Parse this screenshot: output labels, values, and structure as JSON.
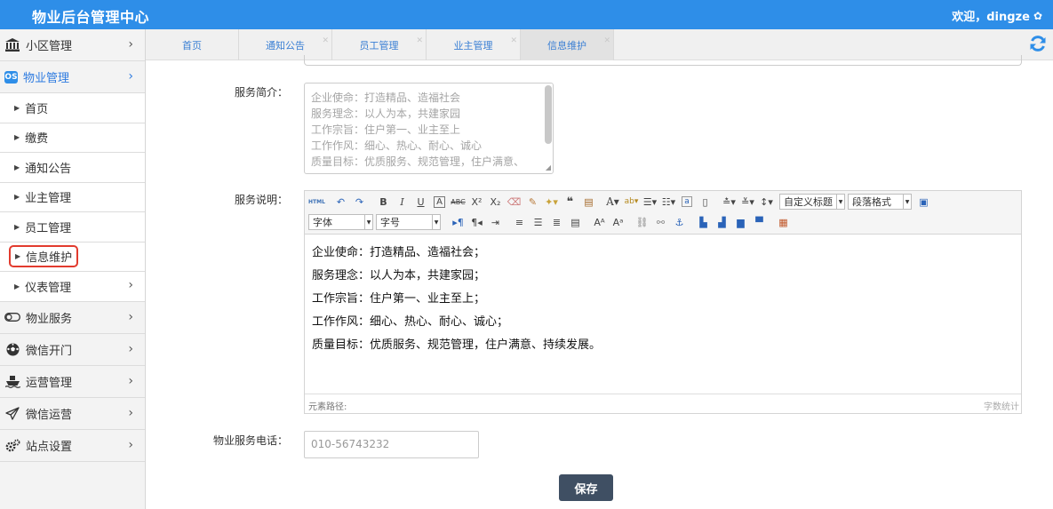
{
  "header": {
    "title": "物业后台管理中心",
    "welcome": "欢迎，dingze",
    "settings_icon": "gear-icon"
  },
  "sidebar": {
    "groups": [
      {
        "label": "小区管理",
        "icon": "building-icon"
      },
      {
        "label": "物业管理",
        "icon": "property-icon",
        "icon_text": "OS",
        "active": true
      },
      {
        "label": "物业服务",
        "icon": "toggle-icon"
      },
      {
        "label": "微信开门",
        "icon": "soccer-icon"
      },
      {
        "label": "运营管理",
        "icon": "ship-icon"
      },
      {
        "label": "微信运营",
        "icon": "paper-plane-icon"
      },
      {
        "label": "站点设置",
        "icon": "gears-icon"
      }
    ],
    "sub_items": [
      {
        "label": "首页"
      },
      {
        "label": "缴费"
      },
      {
        "label": "通知公告"
      },
      {
        "label": "业主管理"
      },
      {
        "label": "员工管理"
      },
      {
        "label": "信息维护",
        "current": true
      },
      {
        "label": "仪表管理",
        "has_children": true
      }
    ]
  },
  "tabs": [
    {
      "label": "首页",
      "closable": false
    },
    {
      "label": "通知公告",
      "closable": true
    },
    {
      "label": "员工管理",
      "closable": true
    },
    {
      "label": "业主管理",
      "closable": true
    },
    {
      "label": "信息维护",
      "closable": true,
      "active": true
    }
  ],
  "form": {
    "intro_label": "服务简介：",
    "intro_lines": [
      "企业使命：打造精品、造福社会",
      "服务理念：以人为本，共建家园",
      "工作宗旨：住户第一、业主至上",
      "工作作风：细心、热心、耐心、诚心",
      "质量目标：优质服务、规范管理，住户满意、"
    ],
    "desc_label": "服务说明：",
    "editor": {
      "font_select": "字体",
      "size_select": "字号",
      "custom_title_select": "自定义标题",
      "paragraph_select": "段落格式",
      "html_button": "HTML",
      "content_lines": [
        "企业使命：打造精品、造福社会；",
        "服务理念：以人为本，共建家园；",
        "工作宗旨：住户第一、业主至上；",
        "工作作风：细心、热心、耐心、诚心；",
        "质量目标：优质服务、规范管理，住户满意、持续发展。"
      ],
      "element_path": "元素路径:",
      "word_count": "字数统计"
    },
    "phone_label": "物业服务电话：",
    "phone_value": "010-56743232",
    "save_label": "保存"
  },
  "colors": {
    "header": "#2e8ee8",
    "active_text": "#2e7be0",
    "current_box": "#e23b2e",
    "save_button": "#3f4f63"
  }
}
